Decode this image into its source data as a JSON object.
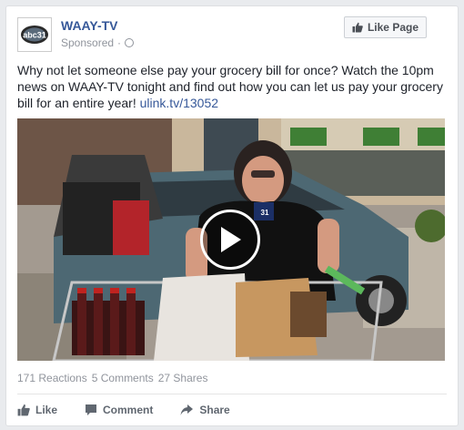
{
  "post": {
    "page_name": "WAAY-TV",
    "sponsored_label": "Sponsored",
    "sponsored_separator": "·",
    "like_page_label": "Like Page",
    "text": "Why not let someone else pay your grocery bill for once? Watch the 10pm news on WAAY-TV tonight and find out how you can let us pay your grocery bill for an entire year! ",
    "link_text": "ulink.tv/13052",
    "avatar_logo_text": "abc31",
    "mic_flag_text": "31"
  },
  "stats": {
    "reactions": "171 Reactions",
    "comments": "5 Comments",
    "shares": "27 Shares"
  },
  "actions": {
    "like": "Like",
    "comment": "Comment",
    "share": "Share"
  },
  "colors": {
    "link": "#365899",
    "muted": "#90949c",
    "action": "#606770"
  },
  "icons": {
    "like_page": "thumbs-up-icon",
    "audience": "globe-icon",
    "play": "play-icon",
    "like": "thumbs-up-icon",
    "comment": "comment-icon",
    "share": "share-icon"
  }
}
